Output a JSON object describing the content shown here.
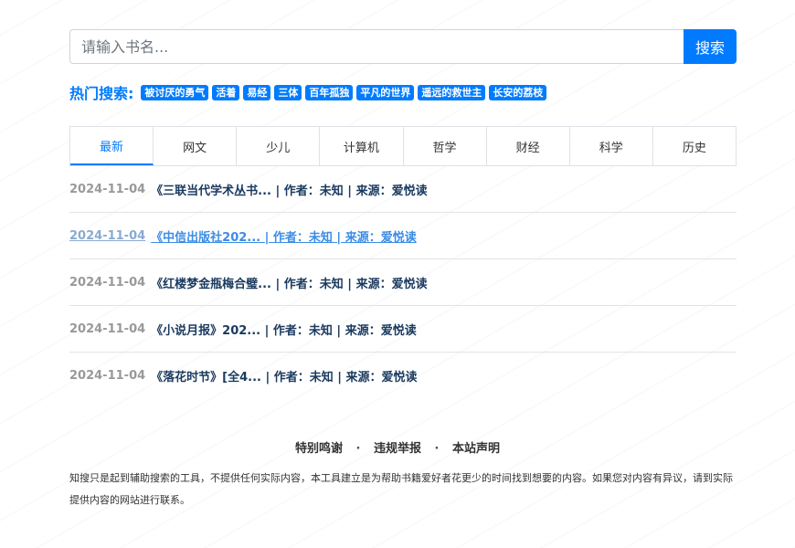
{
  "search": {
    "placeholder": "请输入书名...",
    "button_label": "搜索"
  },
  "hot_searches": {
    "label": "热门搜索:",
    "tags": [
      "被讨厌的勇气",
      "活着",
      "易经",
      "三体",
      "百年孤独",
      "平凡的世界",
      "遥远的救世主",
      "长安的荔枝"
    ]
  },
  "tabs": [
    {
      "label": "最新",
      "active": true
    },
    {
      "label": "网文",
      "active": false
    },
    {
      "label": "少儿",
      "active": false
    },
    {
      "label": "计算机",
      "active": false
    },
    {
      "label": "哲学",
      "active": false
    },
    {
      "label": "财经",
      "active": false
    },
    {
      "label": "科学",
      "active": false
    },
    {
      "label": "历史",
      "active": false
    }
  ],
  "items": [
    {
      "date": "2024-11-04",
      "text": "《三联当代学术丛书... | 作者：未知 | 来源：爱悦读",
      "hover": false
    },
    {
      "date": "2024-11-04",
      "text": "《中信出版社202... | 作者：未知 | 来源：爱悦读",
      "hover": true
    },
    {
      "date": "2024-11-04",
      "text": "《红楼梦金瓶梅合璧... | 作者：未知 | 来源：爱悦读",
      "hover": false
    },
    {
      "date": "2024-11-04",
      "text": "《小说月报》202... | 作者：未知 | 来源：爱悦读",
      "hover": false
    },
    {
      "date": "2024-11-04",
      "text": "《落花时节》[全4... | 作者：未知 | 来源：爱悦读",
      "hover": false
    }
  ],
  "footer": {
    "links": [
      "特别鸣谢",
      "违规举报",
      "本站声明"
    ],
    "separator": "·",
    "disclaimer": "知搜只是起到辅助搜索的工具，不提供任何实际内容，本工具建立是为帮助书籍爱好者花更少的时间找到想要的内容。如果您对内容有异议，请到实际提供内容的网站进行联系。"
  },
  "colors": {
    "accent": "#007bff",
    "link": "#1a3a5f",
    "muted": "#999999"
  }
}
